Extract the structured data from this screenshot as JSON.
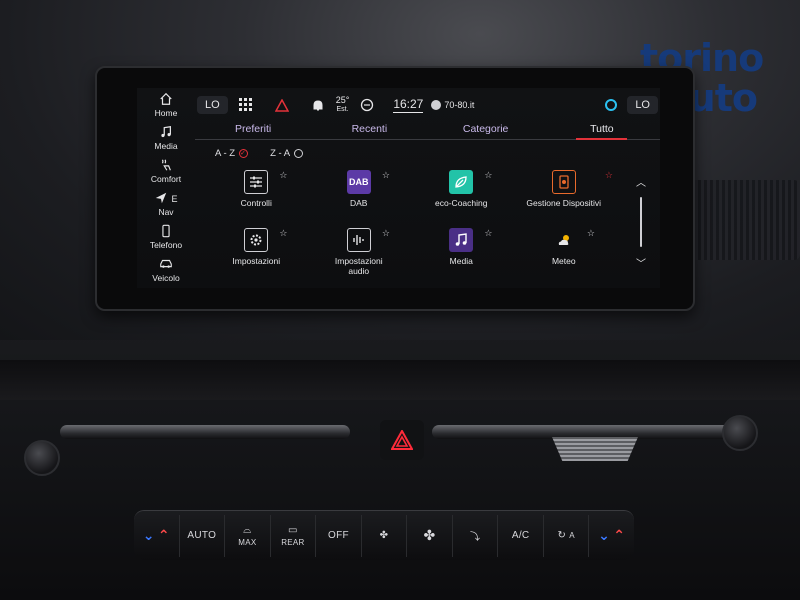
{
  "brand": {
    "line1": "torino",
    "line2": "auto"
  },
  "status_bar": {
    "left_temp": "LO",
    "temperature": "25°",
    "temperature_sub": "Est.",
    "clock": "16:27",
    "radio": "70-80.it",
    "right_temp": "LO"
  },
  "side_nav": [
    {
      "label": "Home",
      "icon": "home-icon"
    },
    {
      "label": "Media",
      "icon": "music-note-icon"
    },
    {
      "label": "Comfort",
      "icon": "seat-heat-icon"
    },
    {
      "label": "Nav",
      "icon": "navigation-arrow-icon",
      "extra": "E"
    },
    {
      "label": "Telefono",
      "icon": "phone-icon"
    },
    {
      "label": "Veicolo",
      "icon": "car-icon"
    }
  ],
  "tabs": [
    {
      "label": "Preferiti",
      "active": false
    },
    {
      "label": "Recenti",
      "active": false
    },
    {
      "label": "Categorie",
      "active": false
    },
    {
      "label": "Tutto",
      "active": true
    }
  ],
  "sort": {
    "az": "A - Z",
    "za": "Z - A",
    "selected": "az"
  },
  "apps": [
    {
      "label": "Controlli",
      "icon": "sliders-icon",
      "favorite": false
    },
    {
      "label": "DAB",
      "icon_text": "DAB",
      "favorite": false
    },
    {
      "label": "eco-Coaching",
      "icon": "leaf-icon",
      "favorite": false
    },
    {
      "label": "Gestione Dispositivi",
      "icon": "device-manager-icon",
      "favorite": true
    },
    {
      "label": "Impostazioni",
      "icon": "gear-icon",
      "favorite": false
    },
    {
      "label": "Impostazioni audio",
      "icon": "audio-bars-icon",
      "favorite": false
    },
    {
      "label": "Media",
      "icon": "music-note-icon",
      "favorite": false
    },
    {
      "label": "Meteo",
      "icon": "weather-icon",
      "favorite": false
    }
  ],
  "climate": {
    "auto": "AUTO",
    "max": "MAX",
    "rear": "REAR",
    "off": "OFF",
    "ac": "A/C",
    "recirc_a": "A"
  },
  "colors": {
    "accent_red": "#e3323a",
    "brand_blue": "#163a7a",
    "tab_purple": "#c9b9ea"
  }
}
